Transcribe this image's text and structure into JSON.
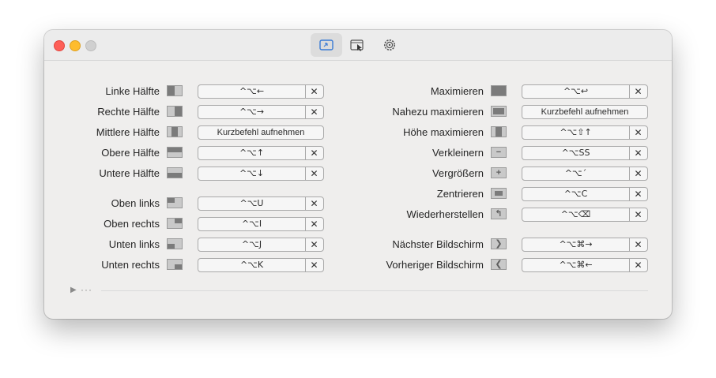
{
  "toolbar": {
    "tabs": [
      {
        "name": "shortcuts",
        "icon": "keyboard-shortcut-icon",
        "active": true
      },
      {
        "name": "snap-areas",
        "icon": "window-cursor-icon",
        "active": false
      },
      {
        "name": "settings",
        "icon": "gear-icon",
        "active": false
      }
    ]
  },
  "left": [
    {
      "label": "Linke Hälfte",
      "key": "^⌥←",
      "icon": "left-half"
    },
    {
      "label": "Rechte Hälfte",
      "key": "^⌥→",
      "icon": "right-half"
    },
    {
      "label": "Mittlere Hälfte",
      "record": "Kurzbefehl aufnehmen",
      "icon": "center-half"
    },
    {
      "label": "Obere Hälfte",
      "key": "^⌥↑",
      "icon": "top-half"
    },
    {
      "label": "Untere Hälfte",
      "key": "^⌥↓",
      "icon": "bottom-half"
    },
    {
      "label": "Oben links",
      "key": "^⌥U",
      "icon": "top-left"
    },
    {
      "label": "Oben rechts",
      "key": "^⌥I",
      "icon": "top-right"
    },
    {
      "label": "Unten links",
      "key": "^⌥J",
      "icon": "bottom-left"
    },
    {
      "label": "Unten rechts",
      "key": "^⌥K",
      "icon": "bottom-right"
    }
  ],
  "right": [
    {
      "label": "Maximieren",
      "key": "^⌥↩",
      "icon": "maximize"
    },
    {
      "label": "Nahezu maximieren",
      "record": "Kurzbefehl aufnehmen",
      "icon": "almost-maximize"
    },
    {
      "label": "Höhe maximieren",
      "key": "^⌥⇧↑",
      "icon": "maximize-height"
    },
    {
      "label": "Verkleinern",
      "key": "^⌥SS",
      "icon": "smaller"
    },
    {
      "label": "Vergrößern",
      "key": "^⌥´",
      "icon": "larger"
    },
    {
      "label": "Zentrieren",
      "key": "^⌥C",
      "icon": "center"
    },
    {
      "label": "Wiederherstellen",
      "key": "^⌥⌫",
      "icon": "restore"
    },
    {
      "label": "Nächster Bildschirm",
      "key": "^⌥⌘→",
      "icon": "next-display"
    },
    {
      "label": "Vorheriger Bildschirm",
      "key": "^⌥⌘←",
      "icon": "previous-display"
    }
  ],
  "clear_symbol": "✕",
  "footer": {
    "arrow": "▶",
    "dots": "···"
  }
}
